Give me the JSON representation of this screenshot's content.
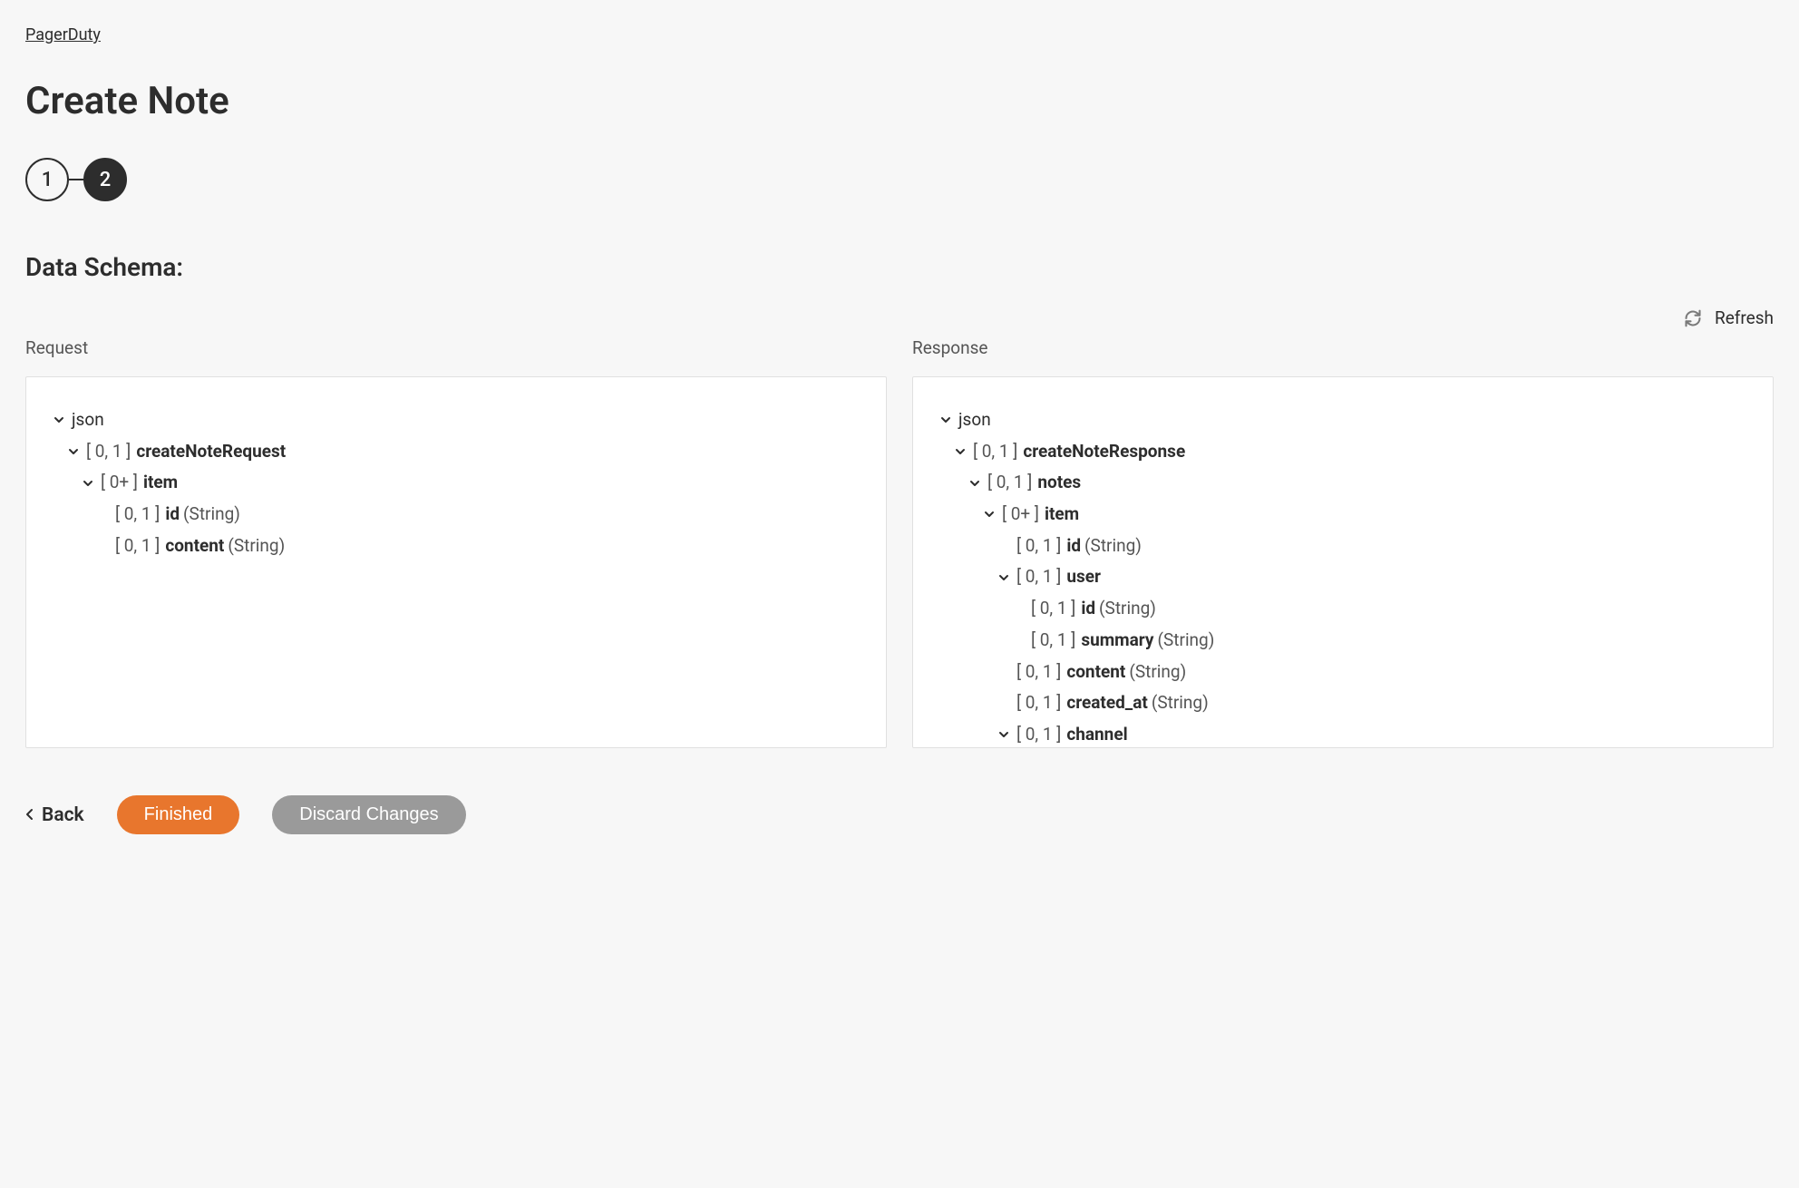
{
  "breadcrumb": "PagerDuty",
  "page_title": "Create Note",
  "stepper": {
    "step1": "1",
    "step2": "2"
  },
  "section_heading": "Data Schema:",
  "refresh": {
    "label": "Refresh"
  },
  "request": {
    "label": "Request",
    "tree": [
      {
        "indent": 0,
        "expandable": true,
        "card": "",
        "key": "json",
        "type": ""
      },
      {
        "indent": 1,
        "expandable": true,
        "card": "[ 0, 1 ]",
        "key": "createNoteRequest",
        "type": ""
      },
      {
        "indent": 2,
        "expandable": true,
        "card": "[ 0+ ]",
        "key": "item",
        "type": ""
      },
      {
        "indent": 3,
        "expandable": false,
        "card": "[ 0, 1 ]",
        "key": "id",
        "type": "(String)"
      },
      {
        "indent": 3,
        "expandable": false,
        "card": "[ 0, 1 ]",
        "key": "content",
        "type": "(String)"
      }
    ]
  },
  "response": {
    "label": "Response",
    "tree": [
      {
        "indent": 0,
        "expandable": true,
        "card": "",
        "key": "json",
        "type": ""
      },
      {
        "indent": 1,
        "expandable": true,
        "card": "[ 0, 1 ]",
        "key": "createNoteResponse",
        "type": ""
      },
      {
        "indent": 2,
        "expandable": true,
        "card": "[ 0, 1 ]",
        "key": "notes",
        "type": ""
      },
      {
        "indent": 3,
        "expandable": true,
        "card": "[ 0+ ]",
        "key": "item",
        "type": ""
      },
      {
        "indent": 4,
        "expandable": false,
        "card": "[ 0, 1 ]",
        "key": "id",
        "type": "(String)"
      },
      {
        "indent": 4,
        "expandable": true,
        "card": "[ 0, 1 ]",
        "key": "user",
        "type": ""
      },
      {
        "indent": 5,
        "expandable": false,
        "card": "[ 0, 1 ]",
        "key": "id",
        "type": "(String)"
      },
      {
        "indent": 5,
        "expandable": false,
        "card": "[ 0, 1 ]",
        "key": "summary",
        "type": "(String)"
      },
      {
        "indent": 4,
        "expandable": false,
        "card": "[ 0, 1 ]",
        "key": "content",
        "type": "(String)"
      },
      {
        "indent": 4,
        "expandable": false,
        "card": "[ 0, 1 ]",
        "key": "created_at",
        "type": "(String)"
      },
      {
        "indent": 4,
        "expandable": true,
        "card": "[ 0, 1 ]",
        "key": "channel",
        "type": ""
      }
    ]
  },
  "footer": {
    "back": "Back",
    "finished": "Finished",
    "discard": "Discard Changes"
  }
}
